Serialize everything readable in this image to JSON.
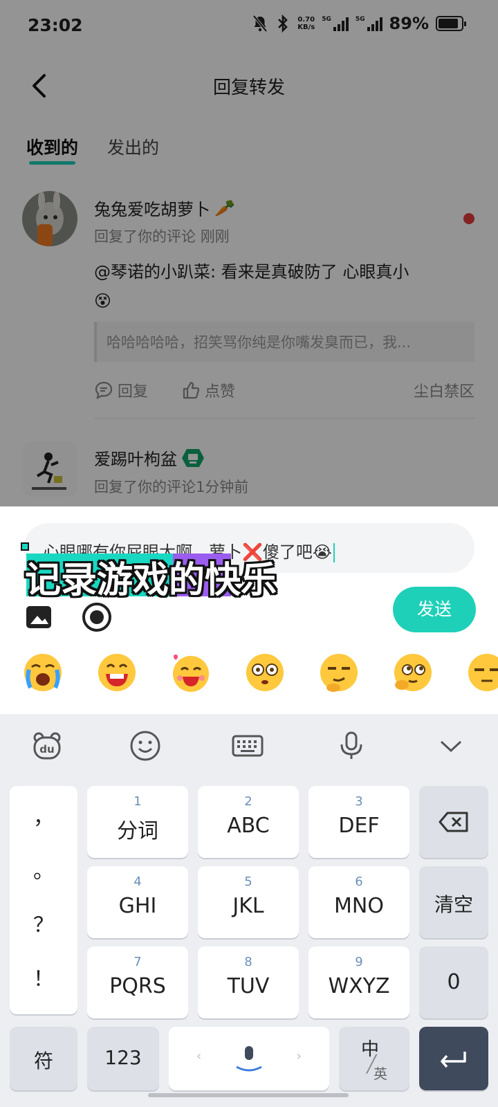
{
  "status_bar": {
    "time": "23:02",
    "speed_value": "0.70",
    "speed_unit": "KB/s",
    "sim1_label": "5G",
    "sim2_label": "5G",
    "battery": "89%"
  },
  "header": {
    "title": "回复转发"
  },
  "tabs": [
    {
      "label": "收到的",
      "active": true
    },
    {
      "label": "发出的",
      "active": false
    }
  ],
  "notices": [
    {
      "username": "兔兔爱吃胡萝卜",
      "username_emoji": "🥕",
      "action": "回复了你的评论",
      "time": "刚刚",
      "content": "@琴诺的小趴菜: 看来是真破防了 心眼真小",
      "content_emoji": "😵",
      "quote": "哈哈哈哈哈，招笑骂你纯是你嘴发臭而已，我...",
      "reply_label": "回复",
      "like_label": "点赞",
      "source": "尘白禁区",
      "unread": true
    },
    {
      "username": "爱踢叶枸盆",
      "action": "回复了你的评论",
      "time": "1分钟前"
    }
  ],
  "reply": {
    "input_text": "心眼哪有你屁眼大啊，萝卜❌傻了吧😭",
    "send_label": "发送",
    "emojis": [
      "crying-face",
      "grinning-face",
      "love-face",
      "dizzy-face",
      "smug-face",
      "pleading-face",
      "unamused-face"
    ]
  },
  "watermark": {
    "text": "记录游戏的快乐"
  },
  "keyboard": {
    "toolbar": [
      "du-bear-icon",
      "smile-icon",
      "keyboard-icon",
      "mic-icon",
      "chevron-down-icon"
    ],
    "punct": [
      "，",
      "。",
      "？",
      "！"
    ],
    "rows": [
      [
        {
          "num": "1",
          "label": "分词"
        },
        {
          "num": "2",
          "label": "ABC"
        },
        {
          "num": "3",
          "label": "DEF"
        }
      ],
      [
        {
          "num": "4",
          "label": "GHI"
        },
        {
          "num": "5",
          "label": "JKL"
        },
        {
          "num": "6",
          "label": "MNO"
        }
      ],
      [
        {
          "num": "7",
          "label": "PQRS"
        },
        {
          "num": "8",
          "label": "TUV"
        },
        {
          "num": "9",
          "label": "WXYZ"
        }
      ]
    ],
    "clear_label": "清空",
    "zero_label": "0",
    "symbol_label": "符",
    "num_switch_label": "123",
    "lang_main": "中",
    "lang_sub": "英"
  }
}
